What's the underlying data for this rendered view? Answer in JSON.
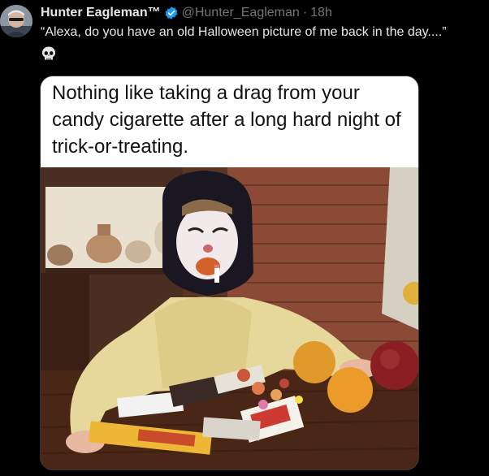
{
  "author": {
    "display_name": "Hunter Eagleman™",
    "handle": "@Hunter_Eagleman",
    "separator": "·",
    "time": "18h"
  },
  "tweet": {
    "text": "“Alexa, do you have an old Halloween picture of me back in the day....”"
  },
  "meme": {
    "caption": "Nothing like taking a drag from your candy cigarette after a long hard night of trick-or-treating."
  },
  "colors": {
    "background": "#000000",
    "text_primary": "#e7e9ea",
    "text_secondary": "#71767b",
    "verified_blue": "#1d9bf0"
  },
  "icons": {
    "verified": "verified-badge-icon",
    "emoji": "skull-emoji-icon",
    "more": "more-icon"
  }
}
